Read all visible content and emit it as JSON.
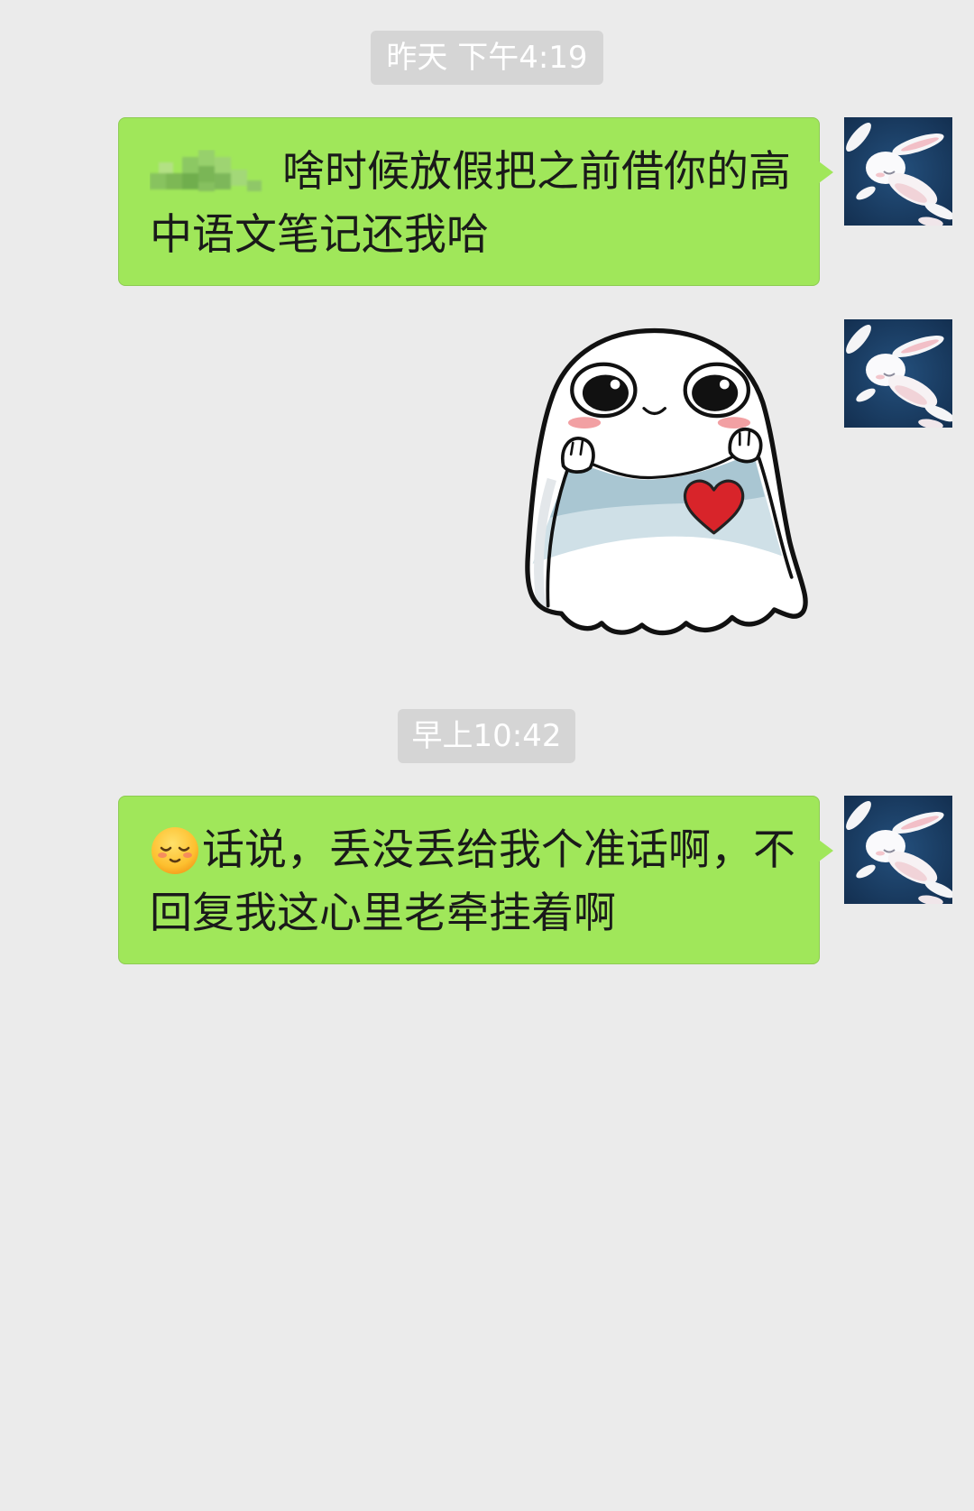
{
  "colors": {
    "background": "#EBEBEB",
    "bubble": "#A0E75A",
    "bubble_border": "#8DCB52",
    "timestamp_bg": "#D5D5D5",
    "timestamp_text": "#FFFFFF",
    "avatar_bg": "#163A5F",
    "heart": "#D8242A"
  },
  "chat": {
    "timestamp_1": "昨天 下午4:19",
    "message_1": {
      "lines": [
        "啥时候放假把之前借你的高",
        "中语文笔记还我哈"
      ]
    },
    "sticker_1": {
      "icon": "ghost-holding-heart-sticker"
    },
    "timestamp_2": "早上10:42",
    "message_2": {
      "emoji_icon": "relieved-face-emoji",
      "lines": [
        "话说，丢没丢给我个准话啊，不",
        "回复我这心里老牵挂着啊"
      ]
    },
    "avatar_icon": "rabbit-avatar"
  }
}
